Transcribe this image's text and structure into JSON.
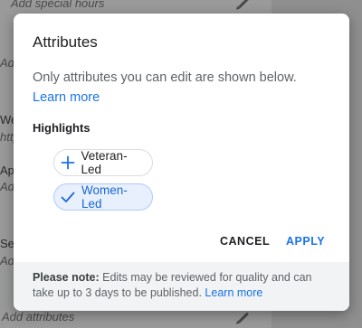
{
  "background": {
    "items": [
      {
        "text": "Add special hours"
      },
      {
        "text": "Add"
      },
      {
        "text": "We"
      },
      {
        "text": "http"
      },
      {
        "text": "App"
      },
      {
        "text": "Add"
      },
      {
        "text": "Se"
      },
      {
        "text": "Add"
      },
      {
        "text": "Add attributes"
      }
    ]
  },
  "dialog": {
    "title": "Attributes",
    "description": "Only attributes you can edit are shown below.",
    "learn_more": "Learn more",
    "section_heading": "Highlights",
    "chips": [
      {
        "label": "Veteran-Led",
        "selected": false,
        "icon": "plus-icon"
      },
      {
        "label": "Women-Led",
        "selected": true,
        "icon": "check-icon"
      }
    ],
    "actions": {
      "cancel": "CANCEL",
      "apply": "APPLY"
    },
    "note": {
      "prefix": "Please note:",
      "text": " Edits may be reviewed for quality and can take up to 3 days to be published. ",
      "link": "Learn more"
    }
  },
  "colors": {
    "accent": "#1a73e8",
    "chip_selected_bg": "#e8f0fe",
    "note_bg": "#f1f3f4"
  }
}
